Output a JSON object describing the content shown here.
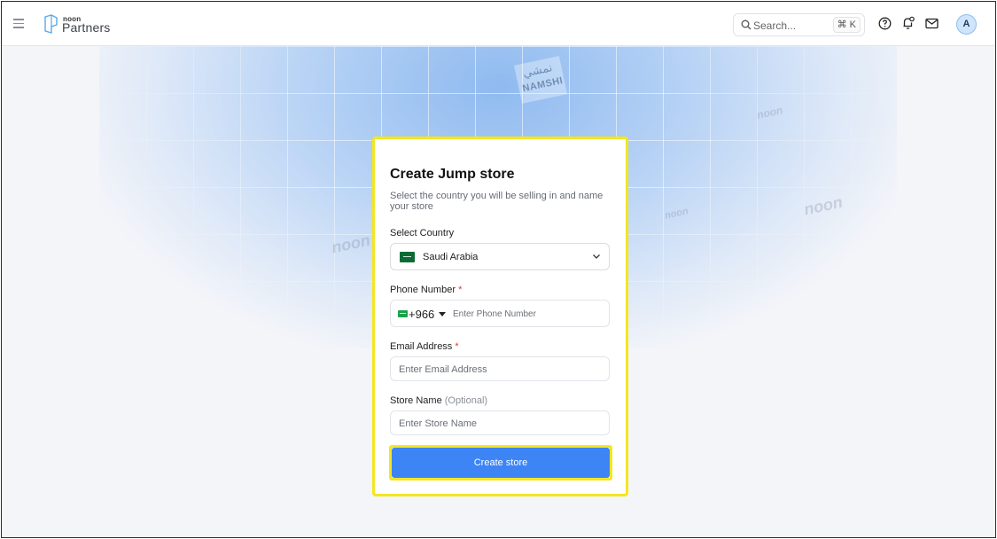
{
  "header": {
    "logo_small": "noon",
    "logo_big": "Partners",
    "search_placeholder": "Search...",
    "search_shortcut": "⌘ K",
    "avatar_initial": "A"
  },
  "background": {
    "namshi_arabic": "نمشي",
    "namshi_latin": "NAMSHI",
    "watermark": "noon"
  },
  "form": {
    "title": "Create Jump store",
    "subtitle": "Select the country you will be selling in and name your store",
    "country_label": "Select Country",
    "country_value": "Saudi Arabia",
    "phone_label": "Phone Number",
    "required_mark": "*",
    "dial_code": "+966",
    "phone_placeholder": "Enter Phone Number",
    "email_label": "Email Address",
    "email_placeholder": "Enter Email Address",
    "store_label": "Store Name",
    "store_optional": "(Optional)",
    "store_placeholder": "Enter Store Name",
    "submit_label": "Create store"
  },
  "colors": {
    "primary": "#3d84f5",
    "highlight": "#f4e620",
    "required": "#e53935"
  }
}
